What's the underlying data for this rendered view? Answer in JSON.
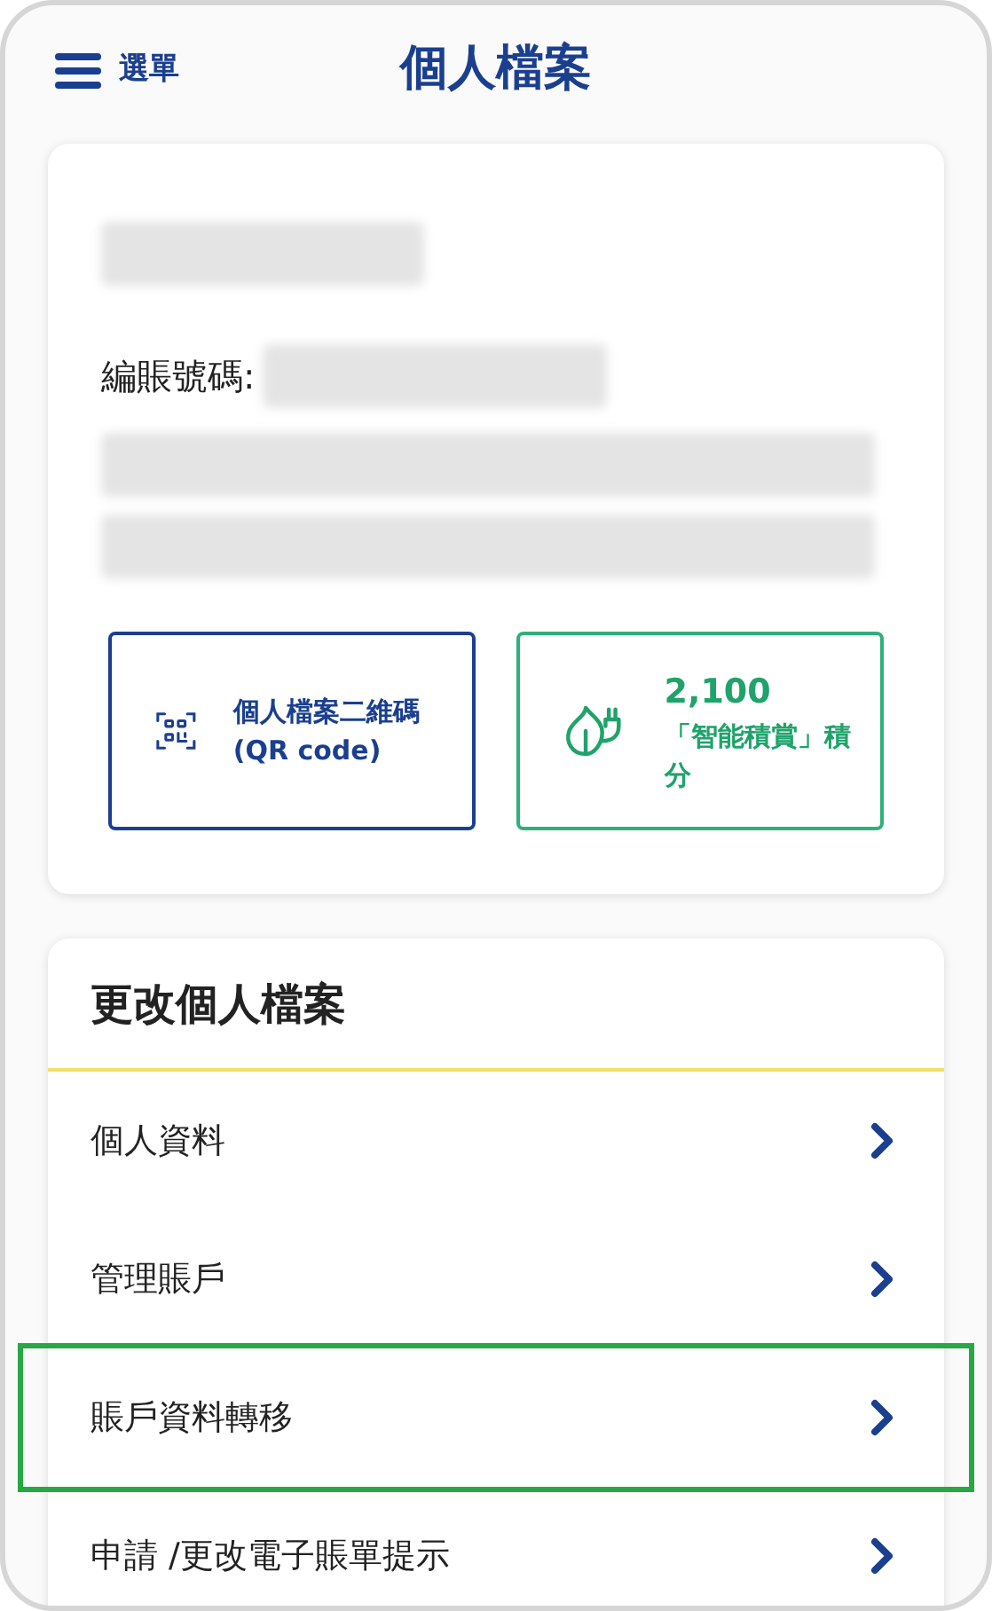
{
  "header": {
    "menu_label": "選單",
    "title": "個人檔案"
  },
  "profile_card": {
    "account_label": "編賬號碼:",
    "actions": [
      {
        "kind": "qr",
        "label": "個人檔案二維碼(QR code)"
      },
      {
        "kind": "points",
        "value": "2,100",
        "label": "「智能積賞」積分"
      }
    ]
  },
  "edit_section": {
    "title": "更改個人檔案",
    "rows": [
      {
        "label": "個人資料",
        "highlighted": false
      },
      {
        "label": "管理賬戶",
        "highlighted": false
      },
      {
        "label": "賬戶資料轉移",
        "highlighted": true
      },
      {
        "label": "申請 /更改電子賬單提示",
        "highlighted": false
      }
    ]
  }
}
